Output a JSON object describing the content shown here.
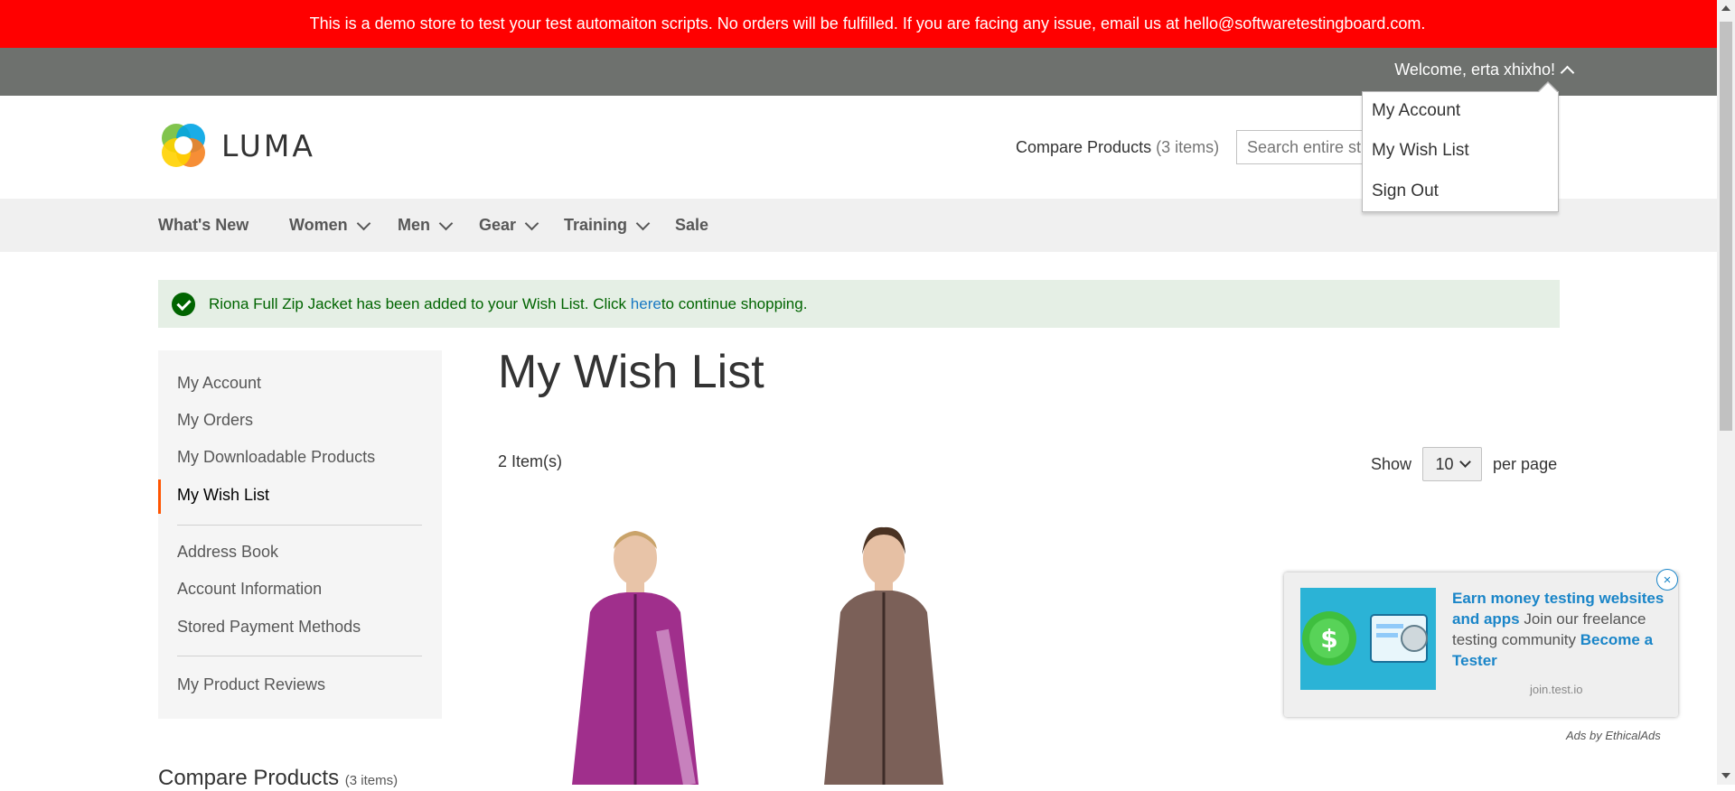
{
  "demo_notice": "This is a demo store to test your test automaiton scripts. No orders will be fulfilled. If you are facing any issue, email us at hello@softwaretestingboard.com.",
  "header": {
    "welcome": "Welcome, erta xhixho!",
    "logo_text": "LUMA",
    "compare_label": "Compare Products",
    "compare_count": "(3 items)",
    "search_placeholder": "Search entire st"
  },
  "account_menu": [
    "My Account",
    "My Wish List",
    "Sign Out"
  ],
  "nav": [
    {
      "label": "What's New",
      "dropdown": false
    },
    {
      "label": "Women",
      "dropdown": true
    },
    {
      "label": "Men",
      "dropdown": true
    },
    {
      "label": "Gear",
      "dropdown": true
    },
    {
      "label": "Training",
      "dropdown": true
    },
    {
      "label": "Sale",
      "dropdown": false
    }
  ],
  "message": {
    "text_before": "Riona Full Zip Jacket has been added to your Wish List. Click ",
    "link": "here",
    "text_after": " to continue shopping."
  },
  "sidebar": {
    "group1": [
      "My Account",
      "My Orders",
      "My Downloadable Products",
      "My Wish List"
    ],
    "current": "My Wish List",
    "group2": [
      "Address Book",
      "Account Information",
      "Stored Payment Methods"
    ],
    "group3": [
      "My Product Reviews"
    ],
    "compare_title": "Compare Products",
    "compare_count": "(3 items)"
  },
  "main": {
    "title": "My Wish List",
    "item_count": "2 Item(s)",
    "show_label": "Show",
    "per_page_value": "10",
    "per_page_label": "per page"
  },
  "ad": {
    "headline": "Earn money testing websites and apps",
    "body": "Join our freelance testing community",
    "cta": "Become a Tester",
    "domain": "join.test.io",
    "attribution": "Ads by EthicalAds",
    "close": "×"
  },
  "colors": {
    "banner": "#ff0000",
    "panel_header": "#6e716e",
    "accent": "#ff5501",
    "link": "#1979c3",
    "success": "#006400"
  }
}
